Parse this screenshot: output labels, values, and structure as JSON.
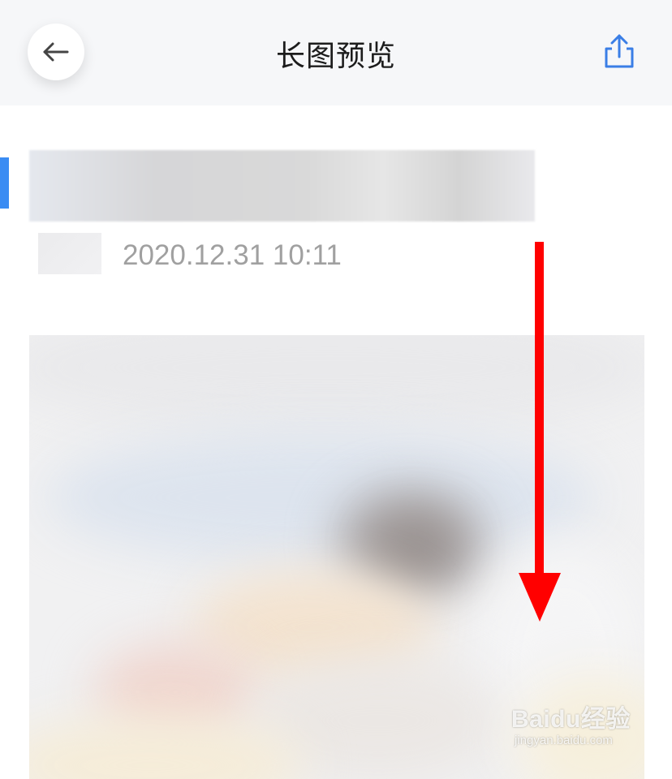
{
  "header": {
    "title": "长图预览",
    "back_icon": "arrow-left-icon",
    "share_icon": "share-upload-icon"
  },
  "post": {
    "timestamp": "2020.12.31 10:11"
  },
  "watermark": {
    "main": "Baidu经验",
    "sub": "jingyan.baidu.com"
  },
  "colors": {
    "accent": "#3a8cf3",
    "annotation_arrow": "#ff0000",
    "header_bg": "#f6f7f9",
    "timestamp": "#a0a0a0"
  }
}
